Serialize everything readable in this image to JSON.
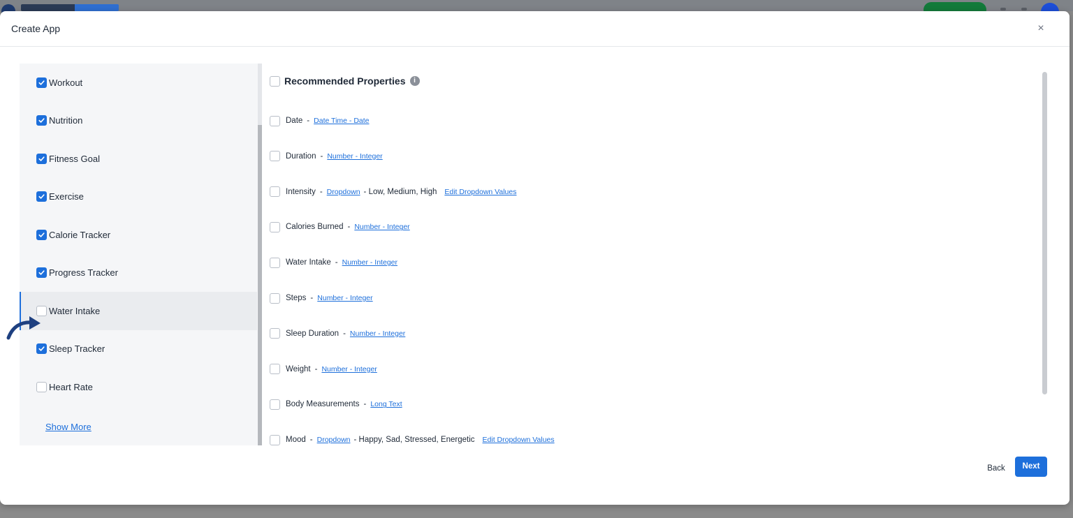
{
  "modal": {
    "title": "Create App",
    "close_icon": "×"
  },
  "sidebar": {
    "items": [
      {
        "label": "Workout",
        "checked": true
      },
      {
        "label": "Nutrition",
        "checked": true
      },
      {
        "label": "Fitness Goal",
        "checked": true
      },
      {
        "label": "Exercise",
        "checked": true
      },
      {
        "label": "Calorie Tracker",
        "checked": true
      },
      {
        "label": "Progress Tracker",
        "checked": true
      },
      {
        "label": "Water Intake",
        "checked": false,
        "active": true
      },
      {
        "label": "Sleep Tracker",
        "checked": true
      },
      {
        "label": "Heart Rate",
        "checked": false
      }
    ],
    "show_more": "Show More"
  },
  "properties": {
    "header": "Recommended Properties",
    "info_icon": "i",
    "dash": "-",
    "rows": [
      {
        "name": "Date",
        "type": "Date Time - Date"
      },
      {
        "name": "Duration",
        "type": "Number - Integer"
      },
      {
        "name": "Intensity",
        "type": "Dropdown",
        "options": "- Low, Medium, High",
        "edit": "Edit Dropdown Values"
      },
      {
        "name": "Calories Burned",
        "type": "Number - Integer"
      },
      {
        "name": "Water Intake",
        "type": "Number - Integer"
      },
      {
        "name": "Steps",
        "type": "Number - Integer"
      },
      {
        "name": "Sleep Duration",
        "type": "Number - Integer"
      },
      {
        "name": "Weight",
        "type": "Number - Integer"
      },
      {
        "name": "Body Measurements",
        "type": "Long Text"
      },
      {
        "name": "Mood",
        "type": "Dropdown",
        "options": "- Happy, Sad, Stressed, Energetic",
        "edit": "Edit Dropdown Values"
      }
    ]
  },
  "footer": {
    "back": "Back",
    "next": "Next"
  },
  "colors": {
    "accent": "#1d6fdb"
  }
}
